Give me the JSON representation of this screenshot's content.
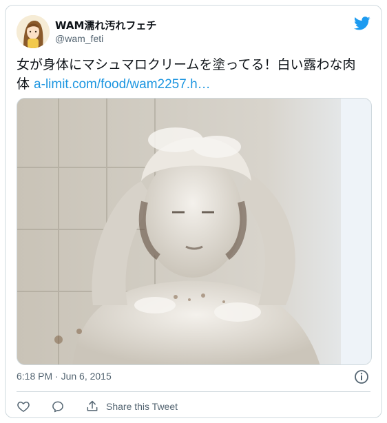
{
  "author": {
    "display_name": "WAM濡れ汚れフェチ",
    "handle": "@wam_feti",
    "avatar_icon": "avatar-illustration",
    "brand_icon": "twitter-bird-icon"
  },
  "tweet": {
    "text": "女が身体にマシュマロクリームを塗ってる！白い露わな肉体 ",
    "link_text": "a-limit.com/food/wam2257.h…",
    "media_description_icon": "photo"
  },
  "meta": {
    "timestamp": "6:18 PM · Jun 6, 2015",
    "info_icon": "info-icon"
  },
  "actions": {
    "like_icon": "heart-icon",
    "reply_icon": "reply-icon",
    "share_icon": "share-icon",
    "share_label": "Share this Tweet"
  },
  "colors": {
    "link": "#1b95e0",
    "secondary_text": "#536471",
    "border": "#cfd9de",
    "twitter_blue": "#1d9bf0"
  }
}
